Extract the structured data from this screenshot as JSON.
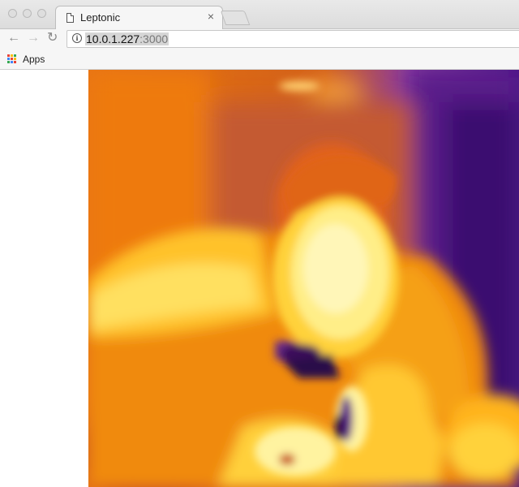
{
  "browser": {
    "tab": {
      "title": "Leptonic",
      "close_glyph": "×"
    },
    "nav": {
      "back_glyph": "←",
      "forward_glyph": "→",
      "reload_glyph": "↻"
    },
    "address": {
      "info_glyph": "i",
      "host": "10.0.1.227",
      "port": ":3000"
    },
    "bookmarks": {
      "apps_label": "Apps"
    }
  },
  "content": {
    "image_kind": "thermal-camera-frame",
    "palette": [
      "#2a0a4a",
      "#5a1a8a",
      "#8a3aa0",
      "#c8501a",
      "#e8740e",
      "#ff9a14",
      "#ffd23a",
      "#fff3a0",
      "#fffbe0"
    ]
  }
}
